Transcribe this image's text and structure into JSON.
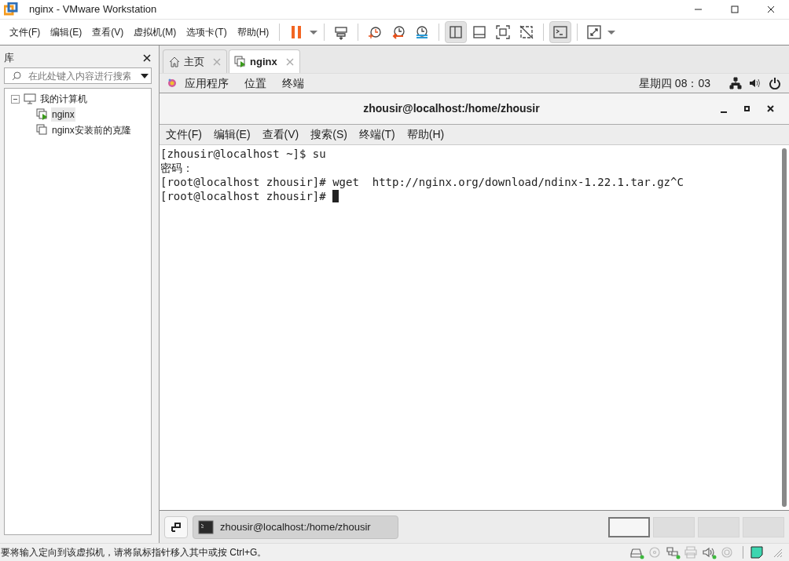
{
  "window": {
    "title": "nginx - VMware Workstation"
  },
  "menu": [
    "文件(F)",
    "编辑(E)",
    "查看(V)",
    "虚拟机(M)",
    "选项卡(T)",
    "帮助(H)"
  ],
  "toolbar": [
    {
      "kind": "pause",
      "pressed": false
    },
    {
      "kind": "dropdown",
      "pressed": false
    },
    {
      "kind": "sep"
    },
    {
      "kind": "send-keys",
      "pressed": false
    },
    {
      "kind": "sep"
    },
    {
      "kind": "snapshot",
      "pressed": false
    },
    {
      "kind": "revert",
      "pressed": false
    },
    {
      "kind": "manage",
      "pressed": false
    },
    {
      "kind": "sep"
    },
    {
      "kind": "sidebar",
      "pressed": true
    },
    {
      "kind": "thumbs",
      "pressed": false
    },
    {
      "kind": "fit",
      "pressed": false
    },
    {
      "kind": "unity",
      "pressed": false
    },
    {
      "kind": "sep"
    },
    {
      "kind": "console",
      "pressed": true
    },
    {
      "kind": "sep"
    },
    {
      "kind": "fullscreen",
      "pressed": false
    },
    {
      "kind": "dropdown",
      "pressed": false
    }
  ],
  "library": {
    "title": "库",
    "search": {
      "placeholder": "在此处键入内容进行搜索"
    },
    "tree": [
      {
        "label": "我的计算机",
        "expanded": true,
        "children": [
          {
            "label": "nginx",
            "selected": true,
            "running": true
          },
          {
            "label": "nginx安装前的克隆",
            "selected": false,
            "running": false
          }
        ]
      }
    ]
  },
  "tabs": [
    {
      "label": "主页",
      "kind": "home",
      "selected": false
    },
    {
      "label": "nginx",
      "kind": "vm",
      "selected": true
    }
  ],
  "guest_bar": {
    "menus": [
      "应用程序",
      "位置",
      "终端"
    ],
    "clock": "星期四 08：03"
  },
  "terminal": {
    "title": "zhousir@localhost:/home/zhousir",
    "menu": [
      "文件(F)",
      "编辑(E)",
      "查看(V)",
      "搜索(S)",
      "终端(T)",
      "帮助(H)"
    ],
    "lines": [
      "[zhousir@localhost ~]$ su",
      "密码：",
      "[root@localhost zhousir]# wget  http://nginx.org/download/ndinx-1.22.1.tar.gz^C",
      "[root@localhost zhousir]# "
    ]
  },
  "taskbar": {
    "task": "zhousir@localhost:/home/zhousir",
    "workspaces": [
      {
        "selected": true
      },
      {
        "selected": false
      },
      {
        "selected": false
      },
      {
        "selected": false
      }
    ]
  },
  "status_bar": {
    "message": "要将输入定向到该虚拟机，请将鼠标指针移入其中或按 Ctrl+G。",
    "devices": [
      {
        "kind": "disk",
        "connected": true
      },
      {
        "kind": "cd",
        "connected": false
      },
      {
        "kind": "network",
        "connected": true
      },
      {
        "kind": "printer",
        "connected": false
      },
      {
        "kind": "sound",
        "connected": true
      },
      {
        "kind": "camera",
        "connected": false
      }
    ]
  }
}
